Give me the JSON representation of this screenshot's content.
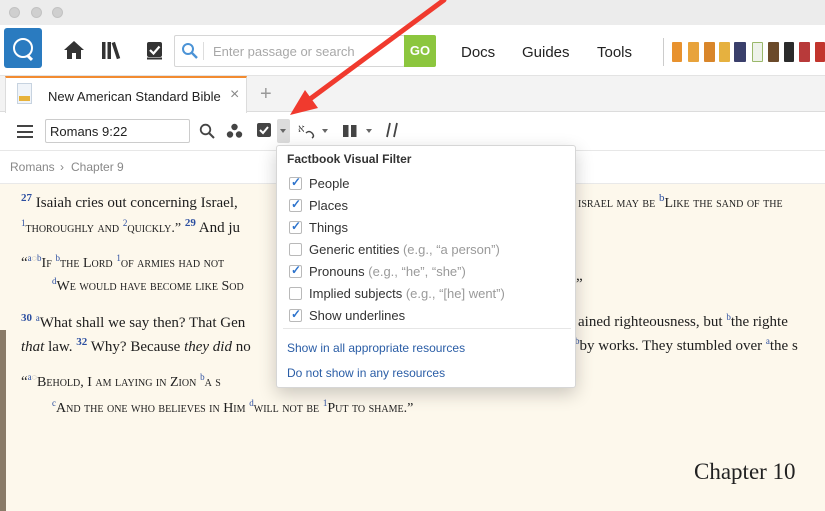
{
  "toolbar": {
    "search_placeholder": "Enter passage or search",
    "go_label": "GO",
    "nav": [
      "Docs",
      "Guides",
      "Tools"
    ],
    "accent_color": "#8cc63e",
    "logo_color": "#2a7bc0"
  },
  "tab": {
    "title": "New American Standard Bible",
    "close_glyph": "×",
    "add_glyph": "+"
  },
  "reference": {
    "value": "Romans 9:22"
  },
  "breadcrumb": {
    "book": "Romans",
    "separator": "›",
    "chapter": "Chapter 9"
  },
  "text": {
    "v27_num": "27",
    "v27_a": "Isaiah cries out concerning Israel,",
    "v27_b": "israel may be",
    "v27_c_mark": "b",
    "v27_c": "Like the sand of the",
    "line2_mark1": "1",
    "line2_a": "thoroughly and",
    "line2_mark2": "2",
    "line2_b": "quickly.”",
    "v29_num": "29",
    "line2_c": "And ju",
    "q1_open": "“",
    "q1_mark": "a",
    "q1_b": "b",
    "q1_text_a": "If",
    "q1_text_b": "the Lord",
    "q1_mark1": "1",
    "q1_text_c": "of armies had not",
    "q2_mark": "d",
    "q2_text": "We would have become like Sod",
    "q2_end": "”",
    "v30_num": "30",
    "v30_mark": "a",
    "v30_a": "What shall we say then? That Gen",
    "v30_b": "ained righteousness, but",
    "v30_mark2": "b",
    "v30_c": "the righte",
    "l5_a": "that",
    "l5_b": "law.",
    "v32_num": "32",
    "l5_c": "Why? Because",
    "l5_d": "they did",
    "l5_e": "no",
    "l5_f_mark": "b",
    "l5_f": "by works. They stumbled over",
    "l5_g_mark": "a",
    "l5_g": "the s",
    "q3_open": "“",
    "q3_mark": "a",
    "q3_text": "Behold, I am laying in Zion",
    "q3_mark2": "b",
    "q3_text2": "a s",
    "q4_mark": "c",
    "q4_text_a": "And the one who believes in Him",
    "q4_mark2": "d",
    "q4_text_b": "will not be",
    "q4_mark3": "1",
    "q4_text_c": "Put to shame.”",
    "chapter_next": "Chapter 10"
  },
  "popup": {
    "title": "Factbook Visual Filter",
    "options": [
      {
        "label": "People",
        "hint": "",
        "checked": true
      },
      {
        "label": "Places",
        "hint": "",
        "checked": true
      },
      {
        "label": "Things",
        "hint": "",
        "checked": true
      },
      {
        "label": "Generic entities",
        "hint": "(e.g., “a person”)",
        "checked": false
      },
      {
        "label": "Pronouns",
        "hint": "(e.g., “he”, “she”)",
        "checked": true
      },
      {
        "label": "Implied subjects",
        "hint": "(e.g., “[he] went”)",
        "checked": false
      },
      {
        "label": "Show underlines",
        "hint": "",
        "checked": true
      }
    ],
    "link_show": "Show in all appropriate resources",
    "link_hide": "Do not show in any resources"
  },
  "annotation": {
    "arrow_color": "#f03a2e"
  }
}
